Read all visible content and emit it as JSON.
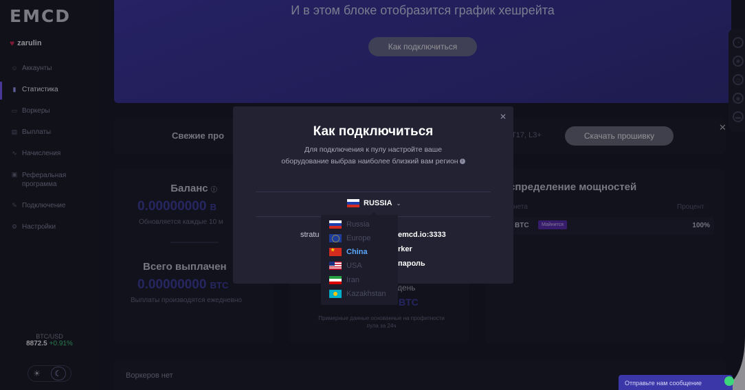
{
  "brand": {
    "logo": "EMCD"
  },
  "user": {
    "name": "zarulin"
  },
  "sidebar": {
    "items": [
      {
        "label": "Аккаунты",
        "icon": "users-icon"
      },
      {
        "label": "Статистика",
        "icon": "chart-icon"
      },
      {
        "label": "Воркеры",
        "icon": "worker-icon"
      },
      {
        "label": "Выплаты",
        "icon": "payout-icon"
      },
      {
        "label": "Начисления",
        "icon": "accrual-icon"
      },
      {
        "label": "Реферальная программа",
        "icon": "referral-icon"
      },
      {
        "label": "Подключение",
        "icon": "wrench-icon"
      },
      {
        "label": "Настройки",
        "icon": "gear-icon"
      }
    ],
    "active_index": 1,
    "rate": {
      "pair": "BTC/USD",
      "value": "8872.5",
      "change": "+0.91%"
    }
  },
  "hero": {
    "subtitle": "И в этом блоке отобразится график хешрейта",
    "button": "Как подключиться"
  },
  "banner": {
    "title": "Свежие про",
    "models": "7, T17, L3+",
    "button": "Скачать прошивку"
  },
  "balance": {
    "title": "Баланс",
    "value": "0.00000000",
    "currency": "B",
    "note": "Обновляется каждые 10 м"
  },
  "paid": {
    "title": "Всего выплачен",
    "value": "0.00000000",
    "currency": "BTC",
    "note": "Выплаты производятся ежедневно"
  },
  "profit": {
    "day": "день",
    "btc": "BTC",
    "footnote": "Примерные данные основанные на профитности пула за 24ч"
  },
  "distribution": {
    "title": "спределение мощностей",
    "col_coin": "нета",
    "col_pct": "Процент",
    "rows": [
      {
        "coin": "BTC",
        "badge": "Майнится",
        "pct": "100%"
      }
    ]
  },
  "workers": {
    "empty": "Воркеров нет"
  },
  "chat": {
    "label": "Отправьте нам сообщение"
  },
  "modal": {
    "title": "Как подключиться",
    "desc": "Для подключения к пулу настройте ваше оборудование выбрав наиболее близкий вам регион",
    "region": "RUSSIA",
    "stratum_label": "stratu",
    "url": "emcd.io:3333",
    "worker": "rker",
    "password": "пароль"
  },
  "regions": [
    {
      "label": "Russia",
      "flag": "ru"
    },
    {
      "label": "Europe",
      "flag": "eu"
    },
    {
      "label": "China",
      "flag": "cn"
    },
    {
      "label": "USA",
      "flag": "us"
    },
    {
      "label": "Iran",
      "flag": "ir"
    },
    {
      "label": "Kazakhstan",
      "flag": "kz"
    }
  ],
  "selected_region": "China",
  "colors": {
    "accent": "#7a5cff",
    "hero": "#3c35a5",
    "positive": "#3ed67a",
    "selected": "#5aa8ff"
  }
}
